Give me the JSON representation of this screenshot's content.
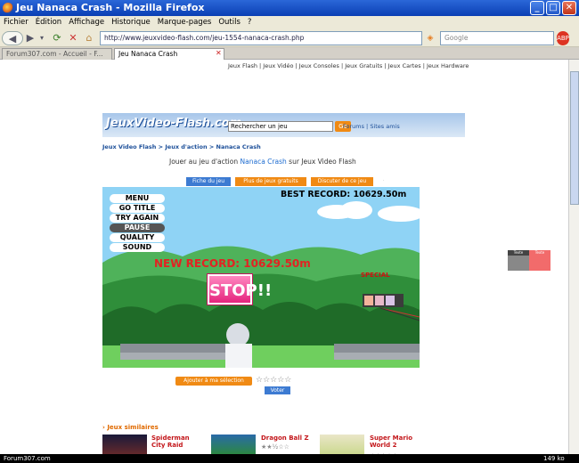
{
  "window": {
    "title": "Jeu Nanaca Crash - Mozilla Firefox",
    "controls": [
      "_",
      "□",
      "✕"
    ]
  },
  "menubar": [
    "Fichier",
    "Édition",
    "Affichage",
    "Historique",
    "Marque-pages",
    "Outils",
    "?"
  ],
  "navbar": {
    "url": "http://www.jeuxvideo-flash.com/jeu-1554-nanaca-crash.php",
    "search_placeholder": "Google"
  },
  "tabs": [
    {
      "label": "Forum307.com - Accueil - F...",
      "active": false
    },
    {
      "label": "Jeu Nanaca Crash",
      "active": true
    }
  ],
  "page": {
    "top_links": "Jeux Flash | Jeux Vidéo | Jeux Consoles | Jeux Gratuits | Jeux Cartes | Jeux Hardware",
    "logo": "JeuxVideo-Flash.com",
    "search_value": "Rechercher un jeu",
    "search_go": "Go",
    "header_links": "Forums | Sites amis",
    "breadcrumb": "Jeux Video Flash  >  Jeux d'action  >  Nanaca Crash",
    "play_line": {
      "prefix": "Jouer au jeu d'action",
      "game": "Nanaca Crash",
      "suffix": "sur Jeux Video Flash"
    },
    "game_buttons": [
      {
        "label": "Fiche du jeu",
        "color": "#3d7bd2"
      },
      {
        "label": "Plus de jeux gratuits",
        "color": "#f08a14"
      },
      {
        "label": "Discuter de ce jeu",
        "color": "#f08a14"
      }
    ],
    "game": {
      "menu_items": [
        "MENU",
        "GO TITLE",
        "TRY AGAIN",
        "PAUSE",
        "QUALITY",
        "SOUND"
      ],
      "selected_item": "PAUSE",
      "best_record": "BEST RECORD:   10629.50m",
      "new_record": "NEW RECORD:  10629.50m",
      "stop_text": "STOP!!",
      "special_label": "SPECIAL"
    },
    "add_selection": "Ajouter à ma sélection",
    "rating_stars": "☆☆☆☆☆",
    "vote_button": "Voter",
    "similar_header": "Jeux similaires",
    "similar_games": [
      {
        "name": "Spiderman City Raid",
        "stars": "★★☆☆☆"
      },
      {
        "name": "Dragon Ball Z",
        "stars": "★★½☆☆"
      },
      {
        "name": "Super Mario World 2",
        "stars": "★★☆☆☆"
      }
    ],
    "side_ad": {
      "left": "Texte",
      "right": "Texte"
    }
  },
  "statusbar": {
    "left": "Forum307.com",
    "right": "149 ko"
  },
  "colors": {
    "titlebar": "#0a3fb4",
    "accent_orange": "#f08a14",
    "accent_blue": "#3d7bd2",
    "record_red": "#e32222",
    "stop_pink": "#e5247d"
  }
}
